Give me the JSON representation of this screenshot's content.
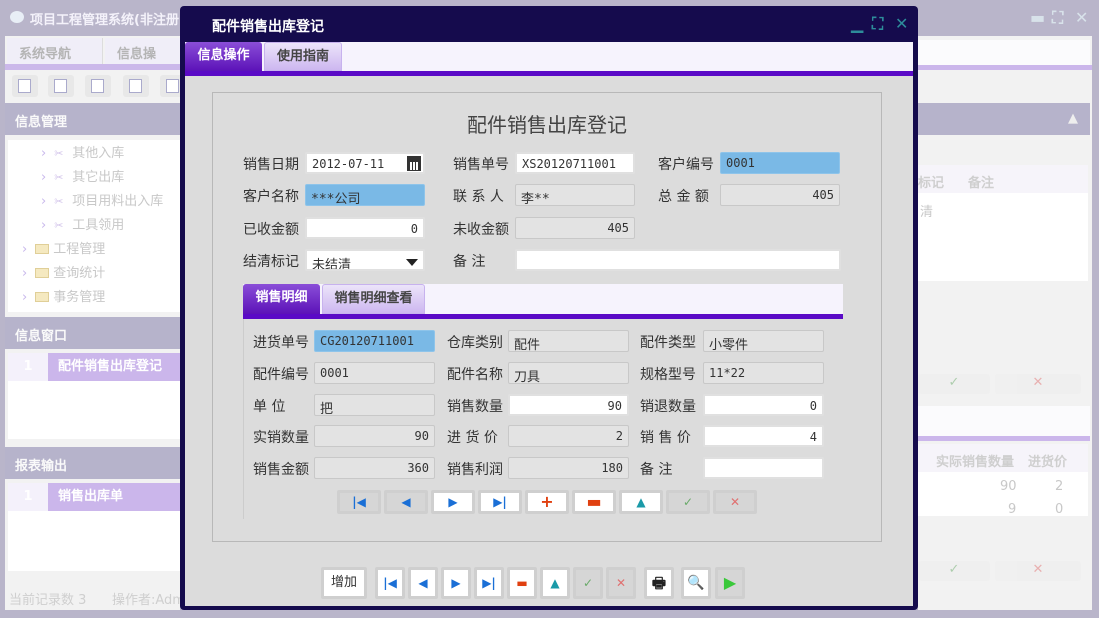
{
  "app": {
    "title": "项目工程管理系统(非注册",
    "tabs": [
      "系统导航",
      "信息操"
    ],
    "sidebar": {
      "section1": "信息管理",
      "items": [
        {
          "label": "其他入库",
          "type": "leaf"
        },
        {
          "label": "其它出库",
          "type": "leaf"
        },
        {
          "label": "项目用料出入库",
          "type": "leaf"
        },
        {
          "label": "工具领用",
          "type": "leaf"
        },
        {
          "label": "工程管理",
          "type": "folder"
        },
        {
          "label": "查询统计",
          "type": "folder"
        },
        {
          "label": "事务管理",
          "type": "folder"
        }
      ],
      "section2": "信息窗口",
      "windows": [
        {
          "no": "1",
          "label": "配件销售出库登记"
        }
      ],
      "section3": "报表输出",
      "reports": [
        {
          "no": "1",
          "label": "销售出库单"
        }
      ]
    },
    "status": {
      "records": "当前记录数 3",
      "operator": "操作者:Adm"
    },
    "right": {
      "col1": "标记",
      "col2": "备注",
      "cell1": "清",
      "col3": "实际销售数量",
      "col4": "进货价",
      "rows": [
        [
          "90",
          "2"
        ],
        [
          "9",
          "0"
        ]
      ],
      "ok": "✓",
      "cancel": "✕"
    }
  },
  "dialog": {
    "title": "配件销售出库登记",
    "tabs": [
      "信息操作",
      "使用指南"
    ],
    "form_title": "配件销售出库登记",
    "fields": {
      "sale_date": {
        "label": "销售日期",
        "value": "2012-07-11"
      },
      "sale_no": {
        "label": "销售单号",
        "value": "XS20120711001"
      },
      "cust_no": {
        "label": "客户编号",
        "value": "0001"
      },
      "cust_name": {
        "label": "客户名称",
        "value": "***公司"
      },
      "contact": {
        "label": "联 系 人",
        "value": "李**"
      },
      "total": {
        "label": "总 金 额",
        "value": "405"
      },
      "received": {
        "label": "已收金额",
        "value": "0"
      },
      "unreceived": {
        "label": "未收金额",
        "value": "405"
      },
      "settle": {
        "label": "结清标记",
        "value": "未结清"
      },
      "remark": {
        "label": "备 注",
        "value": ""
      }
    },
    "detail_tabs": [
      "销售明细",
      "销售明细查看"
    ],
    "detail": {
      "purchase_no": {
        "label": "进货单号",
        "value": "CG20120711001"
      },
      "warehouse": {
        "label": "仓库类别",
        "value": "配件"
      },
      "part_type": {
        "label": "配件类型",
        "value": "小零件"
      },
      "part_no": {
        "label": "配件编号",
        "value": "0001"
      },
      "part_name": {
        "label": "配件名称",
        "value": "刀具"
      },
      "spec": {
        "label": "规格型号",
        "value": "11*22"
      },
      "unit": {
        "label": "单 位",
        "value": "把"
      },
      "qty": {
        "label": "销售数量",
        "value": "90"
      },
      "return_qty": {
        "label": "销退数量",
        "value": "0"
      },
      "actual_qty": {
        "label": "实销数量",
        "value": "90"
      },
      "cost": {
        "label": "进 货 价",
        "value": "2"
      },
      "price": {
        "label": "销 售 价",
        "value": "4"
      },
      "amount": {
        "label": "销售金额",
        "value": "360"
      },
      "profit": {
        "label": "销售利润",
        "value": "180"
      },
      "remark": {
        "label": "备 注",
        "value": ""
      }
    },
    "toolbar": {
      "add": "增加"
    }
  }
}
